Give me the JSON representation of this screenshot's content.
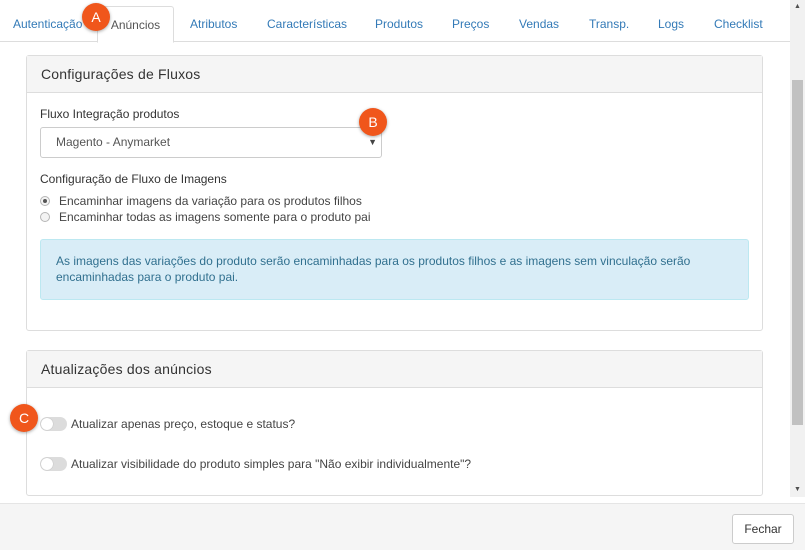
{
  "tabs": [
    {
      "label": "Autenticação"
    },
    {
      "label": "Anúncios"
    },
    {
      "label": "Atributos"
    },
    {
      "label": "Características"
    },
    {
      "label": "Produtos"
    },
    {
      "label": "Preços"
    },
    {
      "label": "Vendas"
    },
    {
      "label": "Transp."
    },
    {
      "label": "Logs"
    },
    {
      "label": "Checklist"
    }
  ],
  "active_tab": "Anúncios",
  "flows_panel": {
    "title": "Configurações de Fluxos",
    "product_flow_label": "Fluxo Integração produtos",
    "product_flow_value": "Magento - Anymarket",
    "image_flow_label": "Configuração de Fluxo de Imagens",
    "image_options": [
      {
        "label": "Encaminhar imagens da variação para os produtos filhos",
        "checked": true
      },
      {
        "label": "Encaminhar todas as imagens somente para o produto pai",
        "checked": false
      }
    ],
    "info_text": "As imagens das variações do produto serão encaminhadas para os produtos filhos e as imagens sem vinculação serão encaminhadas para o produto pai."
  },
  "updates_panel": {
    "title": "Atualizações dos anúncios",
    "toggles": [
      {
        "label": "Atualizar apenas preço, estoque e status?",
        "on": false
      },
      {
        "label": "Atualizar visibilidade do produto simples para \"Não exibir individualmente\"?",
        "on": false
      }
    ]
  },
  "footer": {
    "close_label": "Fechar"
  },
  "markers": [
    "A",
    "B",
    "C"
  ],
  "colors": {
    "link": "#337ab7",
    "marker": "#f0561b",
    "info_bg": "#d9edf7",
    "info_text": "#31708f"
  }
}
